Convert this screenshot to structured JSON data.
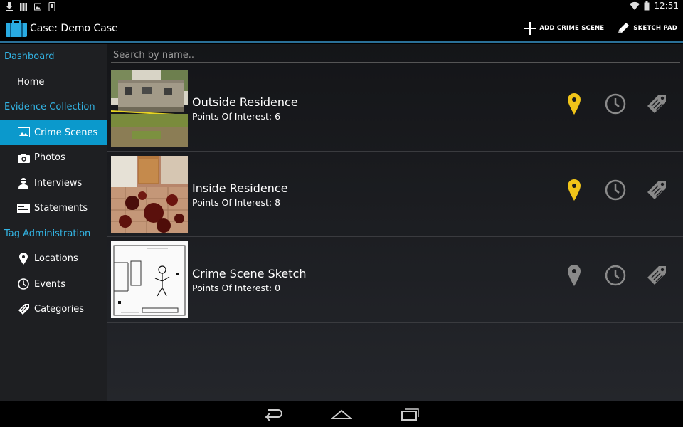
{
  "status_bar": {
    "time": "12:51"
  },
  "action_bar": {
    "title": "Case: Demo Case",
    "add_crime_scene_label": "ADD CRIME SCENE",
    "sketch_pad_label": "SKETCH PAD"
  },
  "sidebar": {
    "dashboard_header": "Dashboard",
    "home_label": "Home",
    "evidence_header": "Evidence Collection",
    "items": [
      {
        "label": "Crime Scenes",
        "icon": "image-icon",
        "selected": true
      },
      {
        "label": "Photos",
        "icon": "camera-icon"
      },
      {
        "label": "Interviews",
        "icon": "person-icon"
      },
      {
        "label": "Statements",
        "icon": "statement-icon"
      }
    ],
    "tag_header": "Tag Administration",
    "tag_items": [
      {
        "label": "Locations",
        "icon": "location-pin-icon"
      },
      {
        "label": "Events",
        "icon": "clock-icon"
      },
      {
        "label": "Categories",
        "icon": "tag-icon"
      }
    ]
  },
  "search": {
    "placeholder": "Search by name.."
  },
  "scenes": [
    {
      "title": "Outside Residence",
      "poi_label": "Points Of Interest:  6",
      "pin_color": "#f0c419"
    },
    {
      "title": "Inside Residence",
      "poi_label": "Points Of Interest:  8",
      "pin_color": "#f0c419"
    },
    {
      "title": "Crime Scene Sketch",
      "poi_label": "Points Of Interest:  0",
      "pin_color": "#8a8a8a"
    }
  ],
  "colors": {
    "accent": "#33b5e5",
    "selected": "#0b99cc",
    "pin_active": "#f0c419",
    "icon_gray": "#8a8a8a"
  }
}
